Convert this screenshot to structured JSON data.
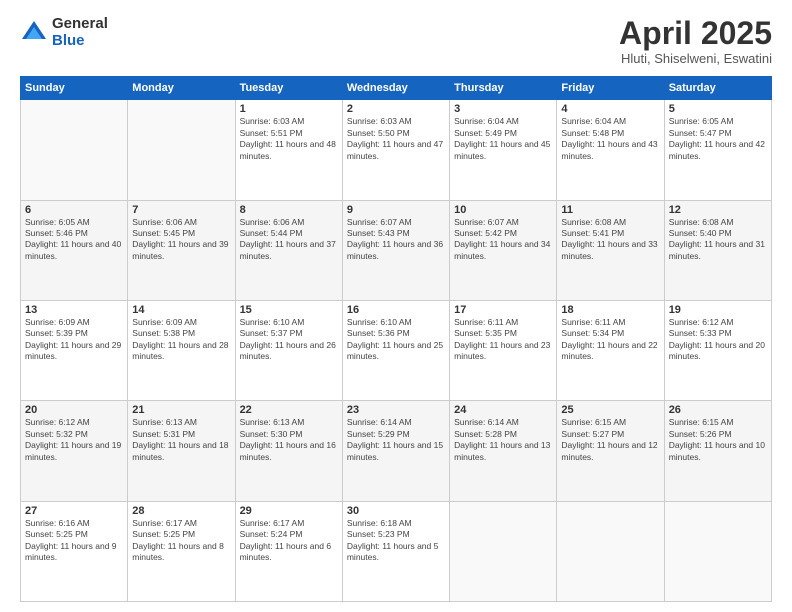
{
  "logo": {
    "general": "General",
    "blue": "Blue"
  },
  "title": "April 2025",
  "subtitle": "Hluti, Shiselweni, Eswatini",
  "headers": [
    "Sunday",
    "Monday",
    "Tuesday",
    "Wednesday",
    "Thursday",
    "Friday",
    "Saturday"
  ],
  "weeks": [
    [
      {
        "day": "",
        "sunrise": "",
        "sunset": "",
        "daylight": ""
      },
      {
        "day": "",
        "sunrise": "",
        "sunset": "",
        "daylight": ""
      },
      {
        "day": "1",
        "sunrise": "Sunrise: 6:03 AM",
        "sunset": "Sunset: 5:51 PM",
        "daylight": "Daylight: 11 hours and 48 minutes."
      },
      {
        "day": "2",
        "sunrise": "Sunrise: 6:03 AM",
        "sunset": "Sunset: 5:50 PM",
        "daylight": "Daylight: 11 hours and 47 minutes."
      },
      {
        "day": "3",
        "sunrise": "Sunrise: 6:04 AM",
        "sunset": "Sunset: 5:49 PM",
        "daylight": "Daylight: 11 hours and 45 minutes."
      },
      {
        "day": "4",
        "sunrise": "Sunrise: 6:04 AM",
        "sunset": "Sunset: 5:48 PM",
        "daylight": "Daylight: 11 hours and 43 minutes."
      },
      {
        "day": "5",
        "sunrise": "Sunrise: 6:05 AM",
        "sunset": "Sunset: 5:47 PM",
        "daylight": "Daylight: 11 hours and 42 minutes."
      }
    ],
    [
      {
        "day": "6",
        "sunrise": "Sunrise: 6:05 AM",
        "sunset": "Sunset: 5:46 PM",
        "daylight": "Daylight: 11 hours and 40 minutes."
      },
      {
        "day": "7",
        "sunrise": "Sunrise: 6:06 AM",
        "sunset": "Sunset: 5:45 PM",
        "daylight": "Daylight: 11 hours and 39 minutes."
      },
      {
        "day": "8",
        "sunrise": "Sunrise: 6:06 AM",
        "sunset": "Sunset: 5:44 PM",
        "daylight": "Daylight: 11 hours and 37 minutes."
      },
      {
        "day": "9",
        "sunrise": "Sunrise: 6:07 AM",
        "sunset": "Sunset: 5:43 PM",
        "daylight": "Daylight: 11 hours and 36 minutes."
      },
      {
        "day": "10",
        "sunrise": "Sunrise: 6:07 AM",
        "sunset": "Sunset: 5:42 PM",
        "daylight": "Daylight: 11 hours and 34 minutes."
      },
      {
        "day": "11",
        "sunrise": "Sunrise: 6:08 AM",
        "sunset": "Sunset: 5:41 PM",
        "daylight": "Daylight: 11 hours and 33 minutes."
      },
      {
        "day": "12",
        "sunrise": "Sunrise: 6:08 AM",
        "sunset": "Sunset: 5:40 PM",
        "daylight": "Daylight: 11 hours and 31 minutes."
      }
    ],
    [
      {
        "day": "13",
        "sunrise": "Sunrise: 6:09 AM",
        "sunset": "Sunset: 5:39 PM",
        "daylight": "Daylight: 11 hours and 29 minutes."
      },
      {
        "day": "14",
        "sunrise": "Sunrise: 6:09 AM",
        "sunset": "Sunset: 5:38 PM",
        "daylight": "Daylight: 11 hours and 28 minutes."
      },
      {
        "day": "15",
        "sunrise": "Sunrise: 6:10 AM",
        "sunset": "Sunset: 5:37 PM",
        "daylight": "Daylight: 11 hours and 26 minutes."
      },
      {
        "day": "16",
        "sunrise": "Sunrise: 6:10 AM",
        "sunset": "Sunset: 5:36 PM",
        "daylight": "Daylight: 11 hours and 25 minutes."
      },
      {
        "day": "17",
        "sunrise": "Sunrise: 6:11 AM",
        "sunset": "Sunset: 5:35 PM",
        "daylight": "Daylight: 11 hours and 23 minutes."
      },
      {
        "day": "18",
        "sunrise": "Sunrise: 6:11 AM",
        "sunset": "Sunset: 5:34 PM",
        "daylight": "Daylight: 11 hours and 22 minutes."
      },
      {
        "day": "19",
        "sunrise": "Sunrise: 6:12 AM",
        "sunset": "Sunset: 5:33 PM",
        "daylight": "Daylight: 11 hours and 20 minutes."
      }
    ],
    [
      {
        "day": "20",
        "sunrise": "Sunrise: 6:12 AM",
        "sunset": "Sunset: 5:32 PM",
        "daylight": "Daylight: 11 hours and 19 minutes."
      },
      {
        "day": "21",
        "sunrise": "Sunrise: 6:13 AM",
        "sunset": "Sunset: 5:31 PM",
        "daylight": "Daylight: 11 hours and 18 minutes."
      },
      {
        "day": "22",
        "sunrise": "Sunrise: 6:13 AM",
        "sunset": "Sunset: 5:30 PM",
        "daylight": "Daylight: 11 hours and 16 minutes."
      },
      {
        "day": "23",
        "sunrise": "Sunrise: 6:14 AM",
        "sunset": "Sunset: 5:29 PM",
        "daylight": "Daylight: 11 hours and 15 minutes."
      },
      {
        "day": "24",
        "sunrise": "Sunrise: 6:14 AM",
        "sunset": "Sunset: 5:28 PM",
        "daylight": "Daylight: 11 hours and 13 minutes."
      },
      {
        "day": "25",
        "sunrise": "Sunrise: 6:15 AM",
        "sunset": "Sunset: 5:27 PM",
        "daylight": "Daylight: 11 hours and 12 minutes."
      },
      {
        "day": "26",
        "sunrise": "Sunrise: 6:15 AM",
        "sunset": "Sunset: 5:26 PM",
        "daylight": "Daylight: 11 hours and 10 minutes."
      }
    ],
    [
      {
        "day": "27",
        "sunrise": "Sunrise: 6:16 AM",
        "sunset": "Sunset: 5:25 PM",
        "daylight": "Daylight: 11 hours and 9 minutes."
      },
      {
        "day": "28",
        "sunrise": "Sunrise: 6:17 AM",
        "sunset": "Sunset: 5:25 PM",
        "daylight": "Daylight: 11 hours and 8 minutes."
      },
      {
        "day": "29",
        "sunrise": "Sunrise: 6:17 AM",
        "sunset": "Sunset: 5:24 PM",
        "daylight": "Daylight: 11 hours and 6 minutes."
      },
      {
        "day": "30",
        "sunrise": "Sunrise: 6:18 AM",
        "sunset": "Sunset: 5:23 PM",
        "daylight": "Daylight: 11 hours and 5 minutes."
      },
      {
        "day": "",
        "sunrise": "",
        "sunset": "",
        "daylight": ""
      },
      {
        "day": "",
        "sunrise": "",
        "sunset": "",
        "daylight": ""
      },
      {
        "day": "",
        "sunrise": "",
        "sunset": "",
        "daylight": ""
      }
    ]
  ]
}
